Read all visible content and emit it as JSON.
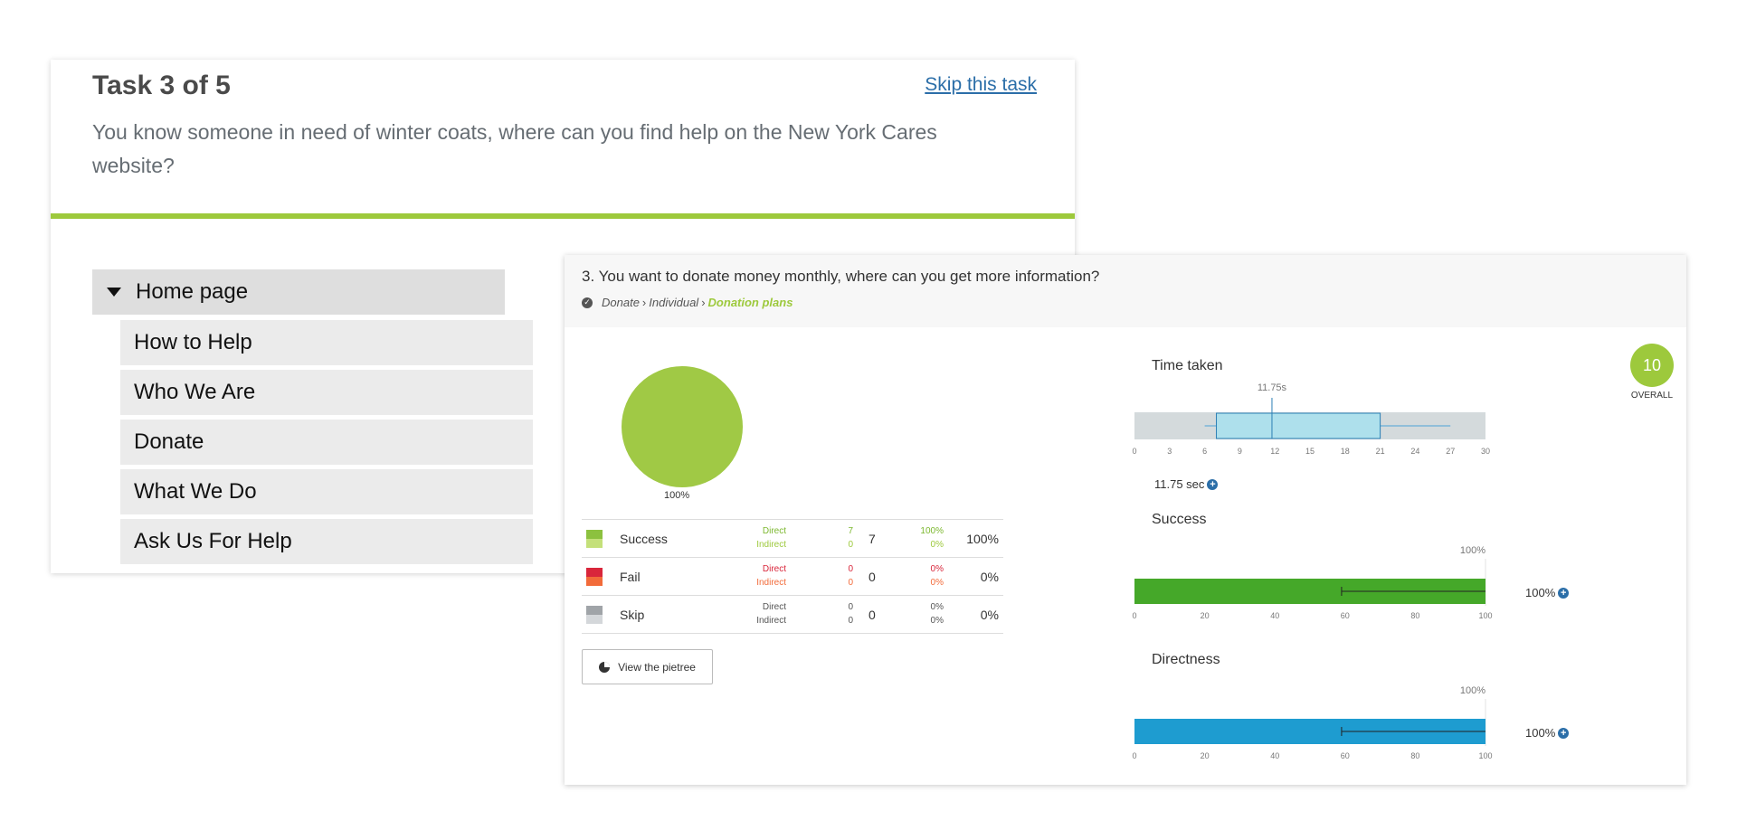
{
  "task": {
    "title": "Task 3 of 5",
    "skip_label": "Skip this task",
    "question": "You know someone in need of winter coats, where can you find help on the New York Cares website?",
    "tree_root": "Home page",
    "tree_items": [
      "How to Help",
      "Who We Are",
      "Donate",
      "What We Do",
      "Ask Us For Help"
    ]
  },
  "results": {
    "question": "3. You want to donate money monthly, where can you get more information?",
    "path": [
      "Donate",
      "Individual",
      "Donation plans"
    ],
    "pie_label": "100%",
    "rows": [
      {
        "name": "Success",
        "direct_label": "Direct",
        "indirect_label": "Indirect",
        "direct": "7",
        "indirect": "0",
        "total": "7",
        "direct_pct": "100%",
        "indirect_pct": "0%",
        "total_pct": "100%",
        "color_top": "#8cc13f",
        "color_bottom": "#c4e07a",
        "text_color": "#7cb82f"
      },
      {
        "name": "Fail",
        "direct_label": "Direct",
        "indirect_label": "Indirect",
        "direct": "0",
        "indirect": "0",
        "total": "0",
        "direct_pct": "0%",
        "indirect_pct": "0%",
        "total_pct": "0%",
        "color_top": "#d9263b",
        "color_bottom": "#f26b3a",
        "text_color": "#d9263b"
      },
      {
        "name": "Skip",
        "direct_label": "Direct",
        "indirect_label": "Indirect",
        "direct": "0",
        "indirect": "0",
        "total": "0",
        "direct_pct": "0%",
        "indirect_pct": "0%",
        "total_pct": "0%",
        "color_top": "#a0a4a8",
        "color_bottom": "#d4d7da",
        "text_color": "#555555"
      }
    ],
    "pietree_button": "View the pietree",
    "overall_score": "10",
    "overall_label": "OVERALL"
  },
  "chart_data": [
    {
      "type": "box",
      "title": "Time taken",
      "median": 11.75,
      "median_label": "11.75s",
      "q1": 7,
      "q3": 21,
      "whisker_low": 6,
      "whisker_high": 27,
      "xlim": [
        0,
        30
      ],
      "ticks": [
        "0",
        "3",
        "6",
        "9",
        "12",
        "15",
        "18",
        "21",
        "24",
        "27",
        "30"
      ],
      "value_label": "11.75 sec"
    },
    {
      "type": "bar",
      "title": "Success",
      "value": 100,
      "error_low": 59,
      "error_high": 100,
      "top_label": "100%",
      "value_label": "100%",
      "xlim": [
        0,
        100
      ],
      "ticks": [
        "0",
        "20",
        "40",
        "60",
        "80",
        "100"
      ],
      "color": "#45a829"
    },
    {
      "type": "bar",
      "title": "Directness",
      "value": 100,
      "error_low": 59,
      "error_high": 100,
      "top_label": "100%",
      "value_label": "100%",
      "xlim": [
        0,
        100
      ],
      "ticks": [
        "0",
        "20",
        "40",
        "60",
        "80",
        "100"
      ],
      "color": "#1e9cd0"
    }
  ]
}
